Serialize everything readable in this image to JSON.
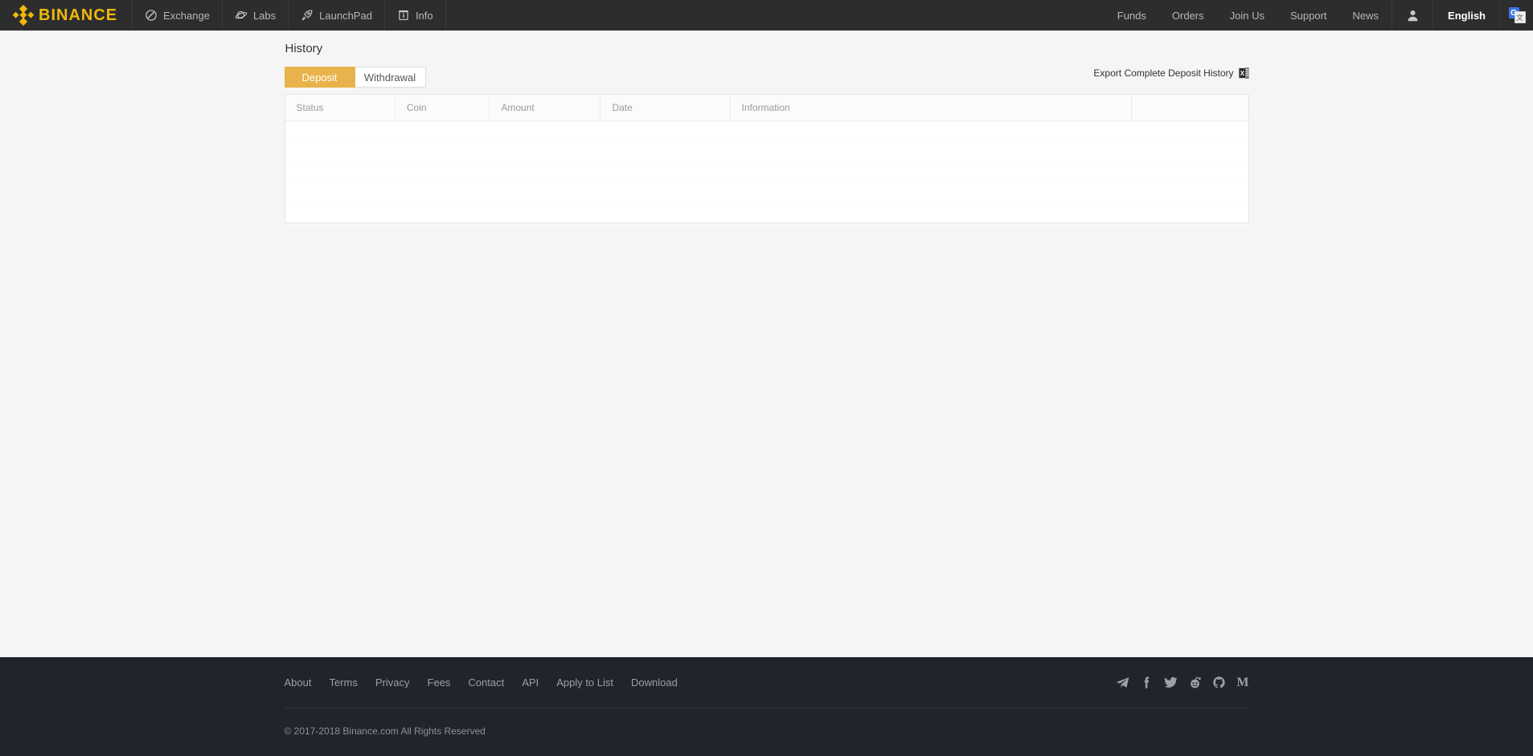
{
  "navbar": {
    "brand": {
      "text": "BINANCE",
      "icon": "binance-diamond-logo",
      "color": "#f0b90b"
    },
    "items": [
      {
        "label": "Exchange",
        "icon": "exchange-circle-slash-icon"
      },
      {
        "label": "Labs",
        "icon": "labs-planet-icon"
      },
      {
        "label": "LaunchPad",
        "icon": "rocket-icon"
      },
      {
        "label": "Info",
        "icon": "info-box-icon"
      }
    ],
    "right_links": [
      {
        "label": "Funds"
      },
      {
        "label": "Orders"
      },
      {
        "label": "Join Us"
      },
      {
        "label": "Support"
      },
      {
        "label": "News"
      }
    ],
    "user_icon": "user-avatar-icon",
    "language": "English",
    "translate_icon": {
      "name": "google-translate-icon",
      "primary": "G",
      "secondary": "文"
    }
  },
  "main": {
    "title": "History",
    "tabs": [
      {
        "label": "Deposit",
        "active": true
      },
      {
        "label": "Withdrawal",
        "active": false
      }
    ],
    "export": {
      "label": "Export Complete Deposit History",
      "icon": "excel-export-icon"
    },
    "table": {
      "columns": [
        "Status",
        "Coin",
        "Amount",
        "Date",
        "Information",
        ""
      ],
      "rows": [],
      "empty_row_count": 5
    }
  },
  "footer": {
    "links": [
      "About",
      "Terms",
      "Privacy",
      "Fees",
      "Contact",
      "API",
      "Apply to List",
      "Download"
    ],
    "social": [
      {
        "name": "telegram-icon"
      },
      {
        "name": "facebook-icon"
      },
      {
        "name": "twitter-icon"
      },
      {
        "name": "reddit-icon"
      },
      {
        "name": "github-icon"
      },
      {
        "name": "medium-icon",
        "glyph": "M"
      }
    ],
    "copyright": "© 2017-2018 Binance.com All Rights Reserved"
  },
  "colors": {
    "brand_yellow": "#f0b90b",
    "accent_gold": "#e8b34b",
    "nav_bg": "#2d2d2d",
    "footer_bg": "#21242a",
    "page_bg": "#f5f5f5"
  }
}
